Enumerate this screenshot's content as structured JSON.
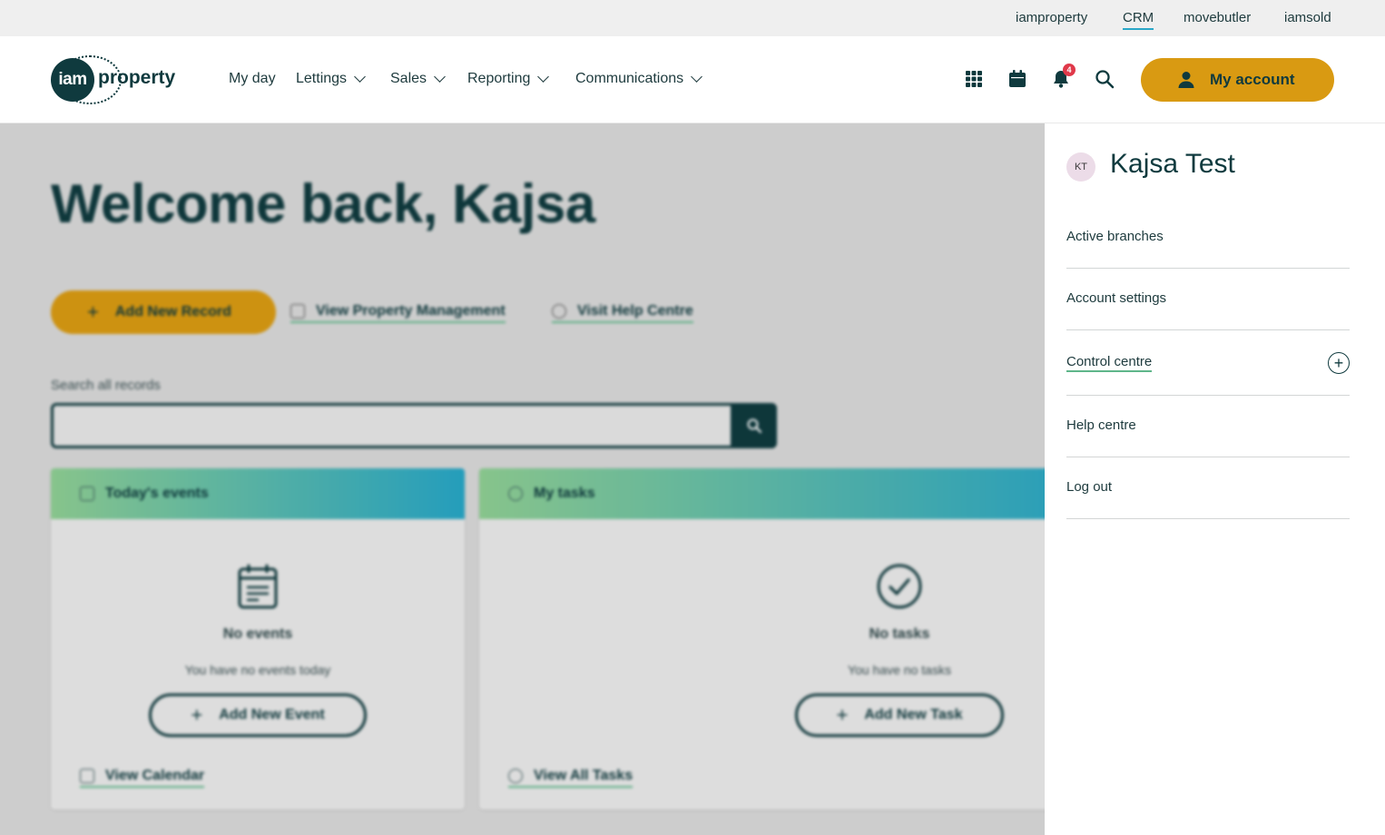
{
  "topbar": {
    "links": [
      "iamproperty",
      "CRM",
      "movebutler",
      "iamsold"
    ],
    "active": "CRM"
  },
  "brand": {
    "logo_circle": "iam",
    "logo_word": "property",
    "primary_color": "#0f3a3e",
    "accent_color": "#d99a12"
  },
  "nav": {
    "items": [
      "My day",
      "Lettings",
      "Sales",
      "Reporting",
      "Communications"
    ]
  },
  "header_icons": [
    "apps-grid-icon",
    "calendar-icon",
    "bell-icon",
    "search-icon"
  ],
  "notifications": {
    "count": "4"
  },
  "account_button": {
    "label": "My account"
  },
  "main": {
    "welcome": "Welcome back, Kajsa",
    "add_record_label": "Add New Record",
    "view_property_management_label": "View Property Management",
    "visit_help_centre_label": "Visit Help Centre",
    "search_label": "Search all records",
    "search_placeholder": ""
  },
  "cards": {
    "events": {
      "title": "Today's events",
      "empty_title": "No events",
      "empty_sub": "You have no events today",
      "button_label": "Add New Event",
      "link_label": "View Calendar"
    },
    "tasks": {
      "title": "My tasks",
      "empty_title": "No tasks",
      "empty_sub": "You have no tasks",
      "button_label": "Add New Task",
      "link_label": "View All Tasks"
    }
  },
  "panel": {
    "initials": "KT",
    "name": "Kajsa Test",
    "items": [
      "Active branches",
      "Account settings",
      "Control centre",
      "Help centre",
      "Log out"
    ]
  }
}
